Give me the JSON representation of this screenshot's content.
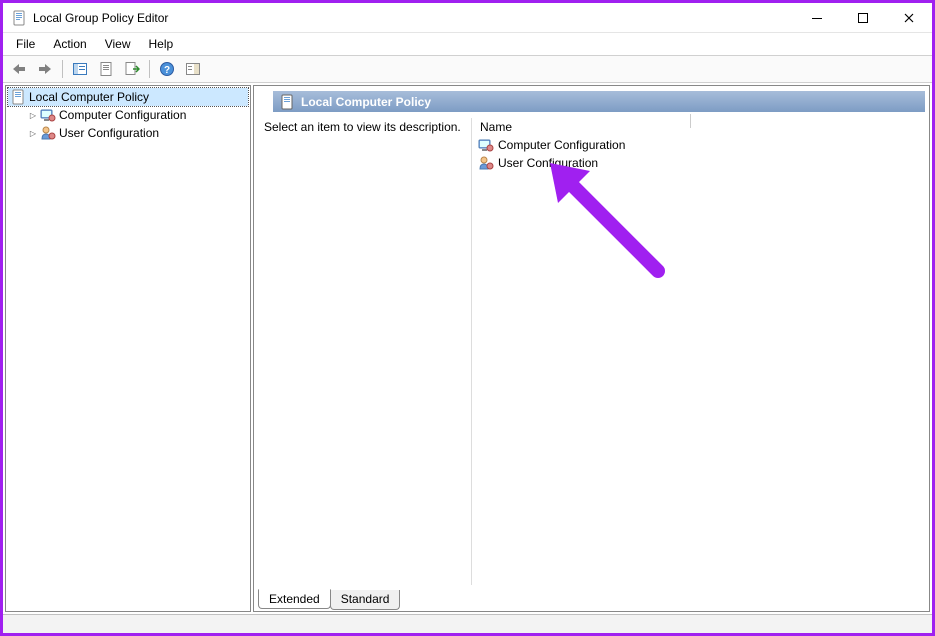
{
  "window": {
    "title": "Local Group Policy Editor"
  },
  "menubar": {
    "items": [
      "File",
      "Action",
      "View",
      "Help"
    ]
  },
  "toolbar": {
    "back": "back-arrow-icon",
    "forward": "forward-arrow-icon",
    "showhide": "show-hide-tree-icon",
    "properties": "properties-icon",
    "export": "export-list-icon",
    "help": "help-icon",
    "showactions": "show-actions-icon"
  },
  "tree": {
    "root": {
      "label": "Local Computer Policy",
      "selected": true
    },
    "children": [
      {
        "label": "Computer Configuration",
        "icon": "computer-config-icon"
      },
      {
        "label": "User Configuration",
        "icon": "user-config-icon"
      }
    ]
  },
  "detail": {
    "header": "Local Computer Policy",
    "description": "Select an item to view its description.",
    "columns": {
      "name": "Name"
    },
    "items": [
      {
        "label": "Computer Configuration",
        "icon": "computer-config-icon"
      },
      {
        "label": "User Configuration",
        "icon": "user-config-icon"
      }
    ],
    "tabs": {
      "extended": "Extended",
      "standard": "Standard",
      "active": "extended"
    }
  },
  "annotation": {
    "color": "#a020f0"
  }
}
